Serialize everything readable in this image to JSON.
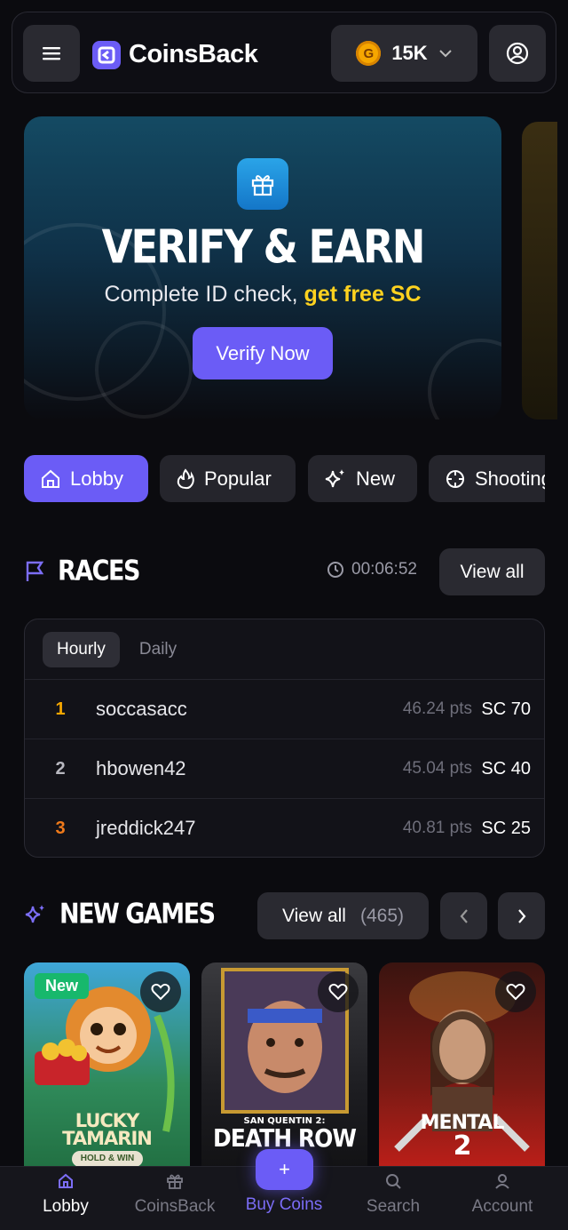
{
  "header": {
    "brand": "CoinsBack",
    "balance": "15K",
    "balance_coin_letter": "G"
  },
  "banner": {
    "title": "VERIFY & EARN",
    "subtitle_prefix": "Complete ID check, ",
    "subtitle_highlight": "get free SC",
    "cta": "Verify Now"
  },
  "categories": [
    {
      "label": "Lobby",
      "icon": "home-icon",
      "active": true
    },
    {
      "label": "Popular",
      "icon": "flame-icon",
      "active": false
    },
    {
      "label": "New",
      "icon": "sparkles-icon",
      "active": false
    },
    {
      "label": "Shooting",
      "icon": "crosshair-icon",
      "active": false
    }
  ],
  "races": {
    "title": "RACES",
    "timer": "00:06:52",
    "view_all": "View all",
    "tabs": [
      {
        "label": "Hourly",
        "active": true
      },
      {
        "label": "Daily",
        "active": false
      }
    ],
    "rows": [
      {
        "rank": "1",
        "name": "soccasacc",
        "points": "46.24 pts",
        "prize": "SC 70"
      },
      {
        "rank": "2",
        "name": "hbowen42",
        "points": "45.04 pts",
        "prize": "SC 40"
      },
      {
        "rank": "3",
        "name": "jreddick247",
        "points": "40.81 pts",
        "prize": "SC 25"
      }
    ],
    "rank_colors": [
      "#f6a700",
      "#b8b8c0",
      "#f07a1a"
    ]
  },
  "new_games": {
    "title": "NEW GAMES",
    "view_all": "View all",
    "count": "(465)",
    "games": [
      {
        "title_line1": "LUCKY",
        "title_line2": "TAMARIN",
        "tagline": "HOLD & WIN",
        "badge": "New"
      },
      {
        "title_line1": "SAN QUENTIN 2:",
        "title_line2": "DEATH ROW"
      },
      {
        "title_line1": "MENTAL",
        "title_line2": "2"
      }
    ]
  },
  "bottom_nav": {
    "items": [
      {
        "label": "Lobby",
        "icon": "home-icon"
      },
      {
        "label": "CoinsBack",
        "icon": "gift-icon"
      },
      {
        "label": "Buy Coins",
        "icon": "plus-icon"
      },
      {
        "label": "Search",
        "icon": "search-icon"
      },
      {
        "label": "Account",
        "icon": "user-icon"
      }
    ],
    "fab_symbol": "+"
  },
  "colors": {
    "accent": "#6b5cf6",
    "highlight": "#ffd21f",
    "new_badge": "#17b86c"
  }
}
